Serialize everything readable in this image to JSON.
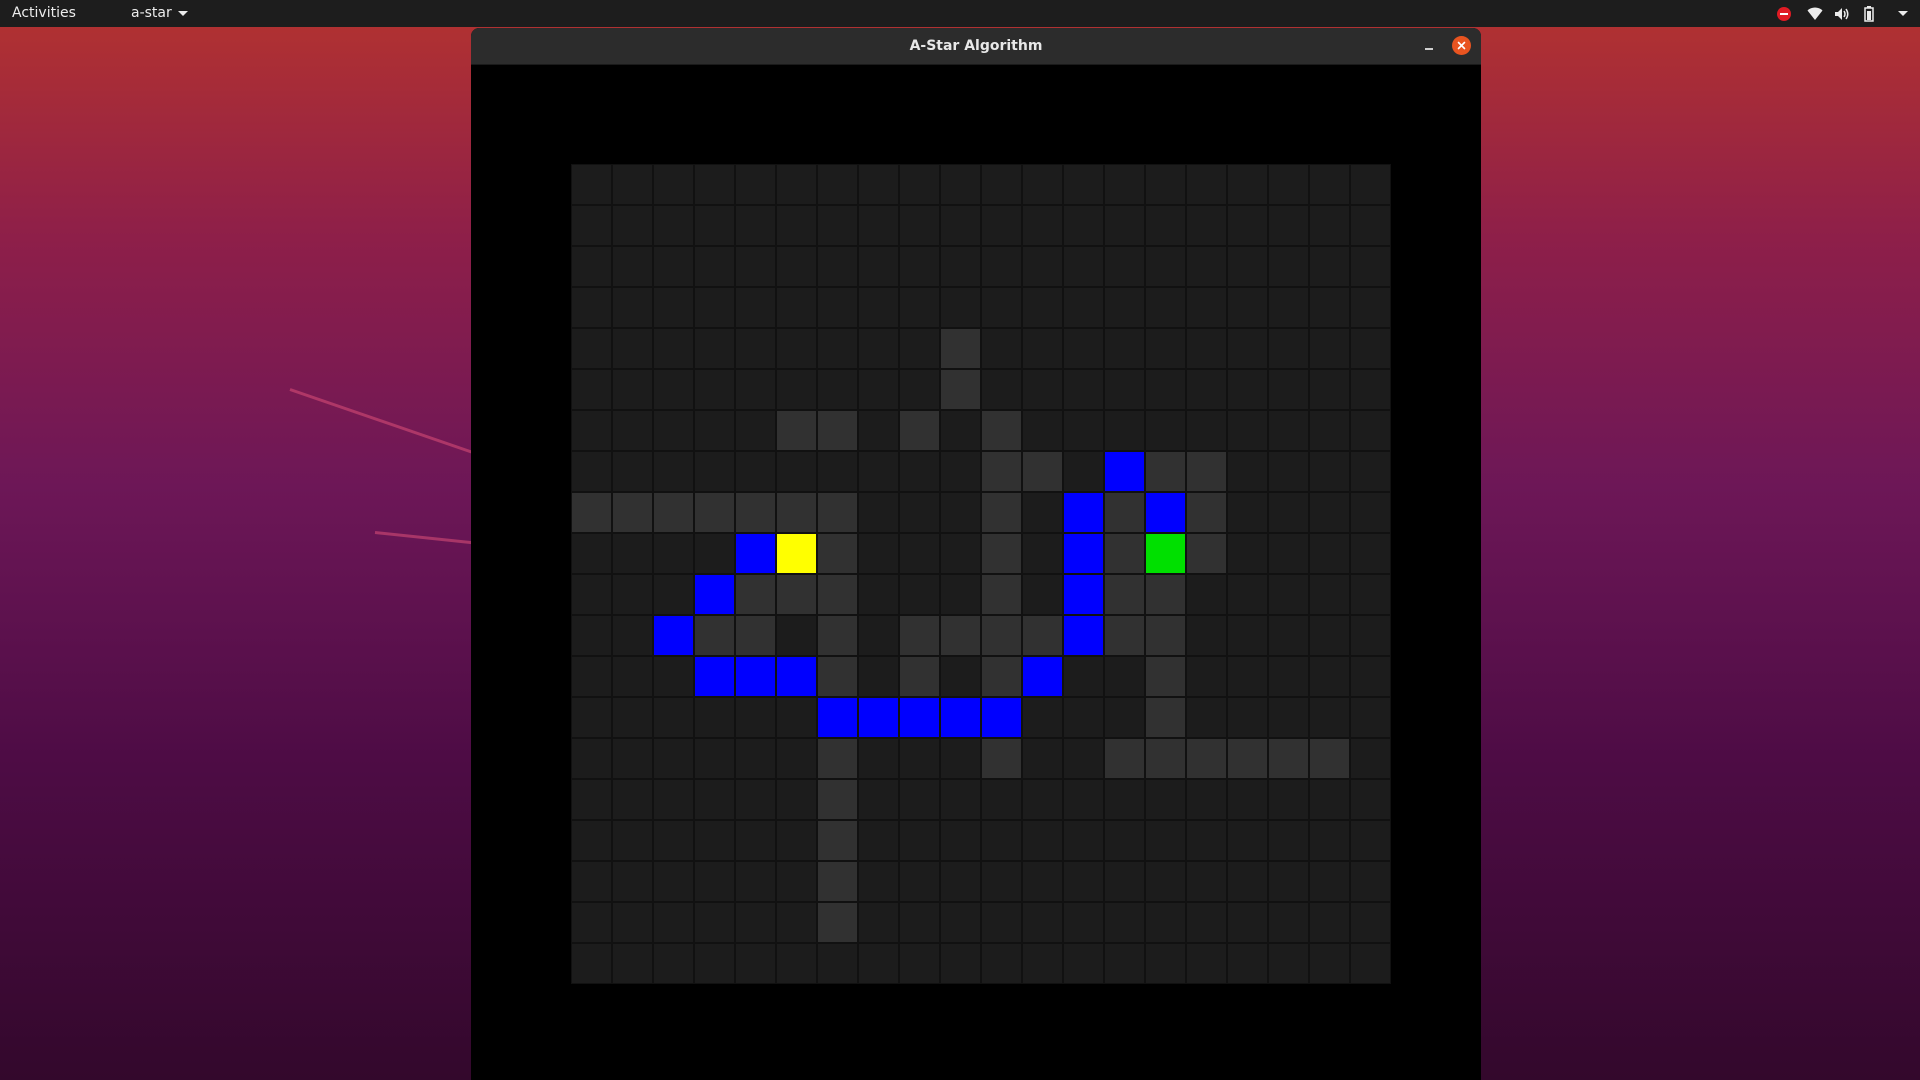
{
  "topbar": {
    "activities": "Activities",
    "app_name": "a-star",
    "icons": [
      "do-not-disturb-icon",
      "wifi-icon",
      "volume-icon",
      "battery-icon",
      "system-menu-caret-icon"
    ]
  },
  "window": {
    "title": "A-Star Algorithm",
    "controls": [
      "minimize-icon",
      "close-icon"
    ]
  },
  "colors": {
    "empty": "#1c1c1c",
    "barrier": "#313131",
    "path": "#0000ff",
    "start": "#ffff00",
    "end": "#00e000",
    "grid_line": "#111111",
    "close_button": "#e95420"
  },
  "grid": {
    "rows": 20,
    "cols": 20,
    "start": [
      9,
      5
    ],
    "end": [
      9,
      14
    ],
    "barriers": [
      [
        4,
        9
      ],
      [
        5,
        9
      ],
      [
        6,
        5
      ],
      [
        6,
        6
      ],
      [
        6,
        8
      ],
      [
        6,
        10
      ],
      [
        7,
        10
      ],
      [
        7,
        11
      ],
      [
        7,
        14
      ],
      [
        7,
        15
      ],
      [
        8,
        0
      ],
      [
        8,
        1
      ],
      [
        8,
        2
      ],
      [
        8,
        3
      ],
      [
        8,
        4
      ],
      [
        8,
        5
      ],
      [
        8,
        6
      ],
      [
        8,
        10
      ],
      [
        8,
        13
      ],
      [
        8,
        15
      ],
      [
        9,
        6
      ],
      [
        9,
        10
      ],
      [
        9,
        13
      ],
      [
        9,
        15
      ],
      [
        10,
        4
      ],
      [
        10,
        5
      ],
      [
        10,
        6
      ],
      [
        10,
        10
      ],
      [
        10,
        13
      ],
      [
        10,
        14
      ],
      [
        11,
        3
      ],
      [
        11,
        4
      ],
      [
        11,
        6
      ],
      [
        11,
        8
      ],
      [
        11,
        9
      ],
      [
        11,
        10
      ],
      [
        11,
        11
      ],
      [
        11,
        13
      ],
      [
        11,
        14
      ],
      [
        12,
        6
      ],
      [
        12,
        8
      ],
      [
        12,
        10
      ],
      [
        12,
        14
      ],
      [
        13,
        14
      ],
      [
        14,
        6
      ],
      [
        14,
        10
      ],
      [
        14,
        13
      ],
      [
        14,
        14
      ],
      [
        14,
        15
      ],
      [
        14,
        16
      ],
      [
        14,
        17
      ],
      [
        14,
        18
      ],
      [
        15,
        6
      ],
      [
        16,
        6
      ],
      [
        17,
        6
      ],
      [
        18,
        6
      ]
    ],
    "path": [
      [
        9,
        4
      ],
      [
        10,
        3
      ],
      [
        11,
        2
      ],
      [
        12,
        3
      ],
      [
        12,
        4
      ],
      [
        12,
        5
      ],
      [
        13,
        6
      ],
      [
        13,
        7
      ],
      [
        13,
        8
      ],
      [
        13,
        9
      ],
      [
        13,
        10
      ],
      [
        12,
        11
      ],
      [
        11,
        12
      ],
      [
        10,
        12
      ],
      [
        9,
        12
      ],
      [
        8,
        12
      ],
      [
        7,
        13
      ],
      [
        8,
        14
      ]
    ]
  }
}
